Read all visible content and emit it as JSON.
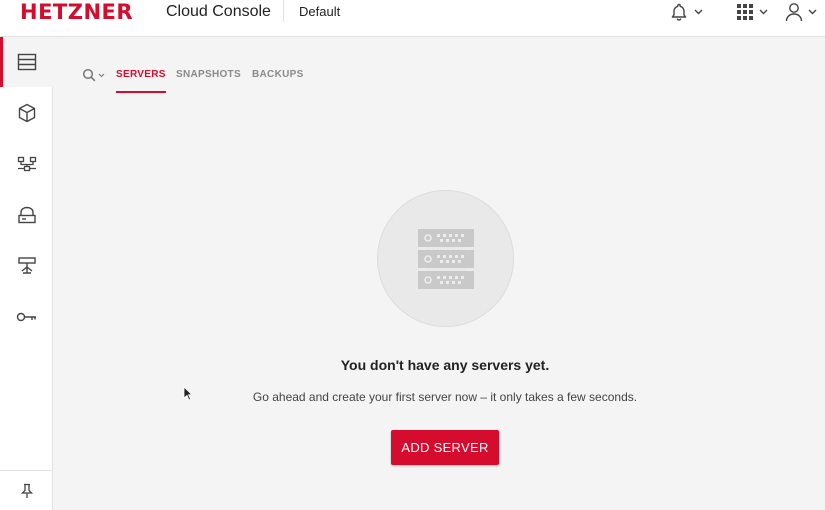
{
  "header": {
    "brand": "HETZNER",
    "app_title": "Cloud Console",
    "project": "Default"
  },
  "icons": {
    "notifications": "bell-icon",
    "apps": "grid-icon",
    "account": "user-icon"
  },
  "sidebar": {
    "items": [
      {
        "icon": "servers-icon",
        "active": true
      },
      {
        "icon": "cube-icon",
        "active": false
      },
      {
        "icon": "network-icon",
        "active": false
      },
      {
        "icon": "volume-icon",
        "active": false
      },
      {
        "icon": "load-balancer-icon",
        "active": false
      },
      {
        "icon": "key-icon",
        "active": false
      }
    ],
    "bottom_icon": "pin-icon"
  },
  "tabs": [
    {
      "label": "SERVERS",
      "active": true
    },
    {
      "label": "SNAPSHOTS",
      "active": false
    },
    {
      "label": "BACKUPS",
      "active": false
    }
  ],
  "empty_state": {
    "title": "You don't have any servers yet.",
    "description": "Go ahead and create your first server now – it only takes a few seconds.",
    "button_label": "ADD SERVER"
  },
  "colors": {
    "brand": "#d50c2d",
    "background": "#f4f4f4",
    "icon": "#555555"
  }
}
